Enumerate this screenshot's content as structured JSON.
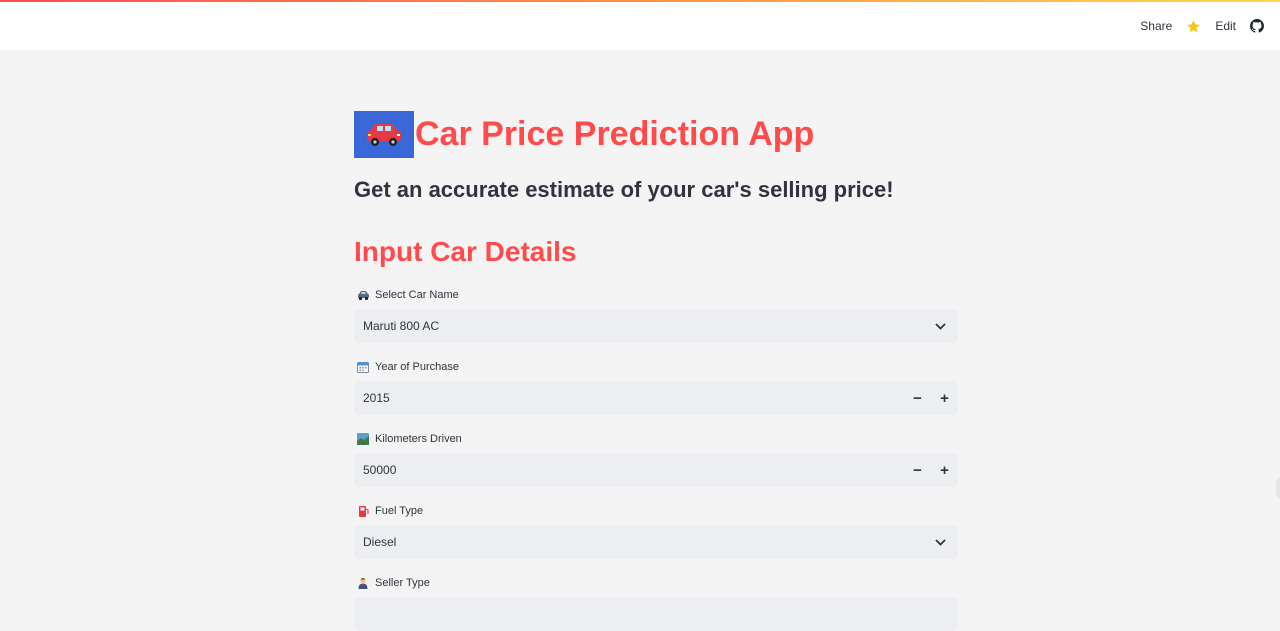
{
  "header": {
    "share_label": "Share",
    "edit_label": "Edit",
    "icons": [
      "star-icon",
      "github-icon"
    ]
  },
  "app": {
    "title": "Car Price Prediction App",
    "subtitle": "Get an accurate estimate of your car's selling price!",
    "section_title": "Input Car Details"
  },
  "fields": {
    "car_name": {
      "label": "Select Car Name",
      "value": "Maruti 800 AC",
      "icon": "car-icon"
    },
    "year": {
      "label": "Year of Purchase",
      "value": "2015",
      "icon": "calendar-icon",
      "minus": "−",
      "plus": "+"
    },
    "km": {
      "label": "Kilometers Driven",
      "value": "50000",
      "icon": "road-icon",
      "minus": "−",
      "plus": "+"
    },
    "fuel": {
      "label": "Fuel Type",
      "value": "Diesel",
      "icon": "fuel-pump-icon"
    },
    "seller": {
      "label": "Seller Type",
      "icon": "person-icon"
    }
  },
  "colors": {
    "accent": "#ff4b4b",
    "logo_bg": "#3b68d9",
    "star": "#f5c518",
    "page_bg": "#f4f4f4",
    "input_bg": "#eceef2"
  }
}
